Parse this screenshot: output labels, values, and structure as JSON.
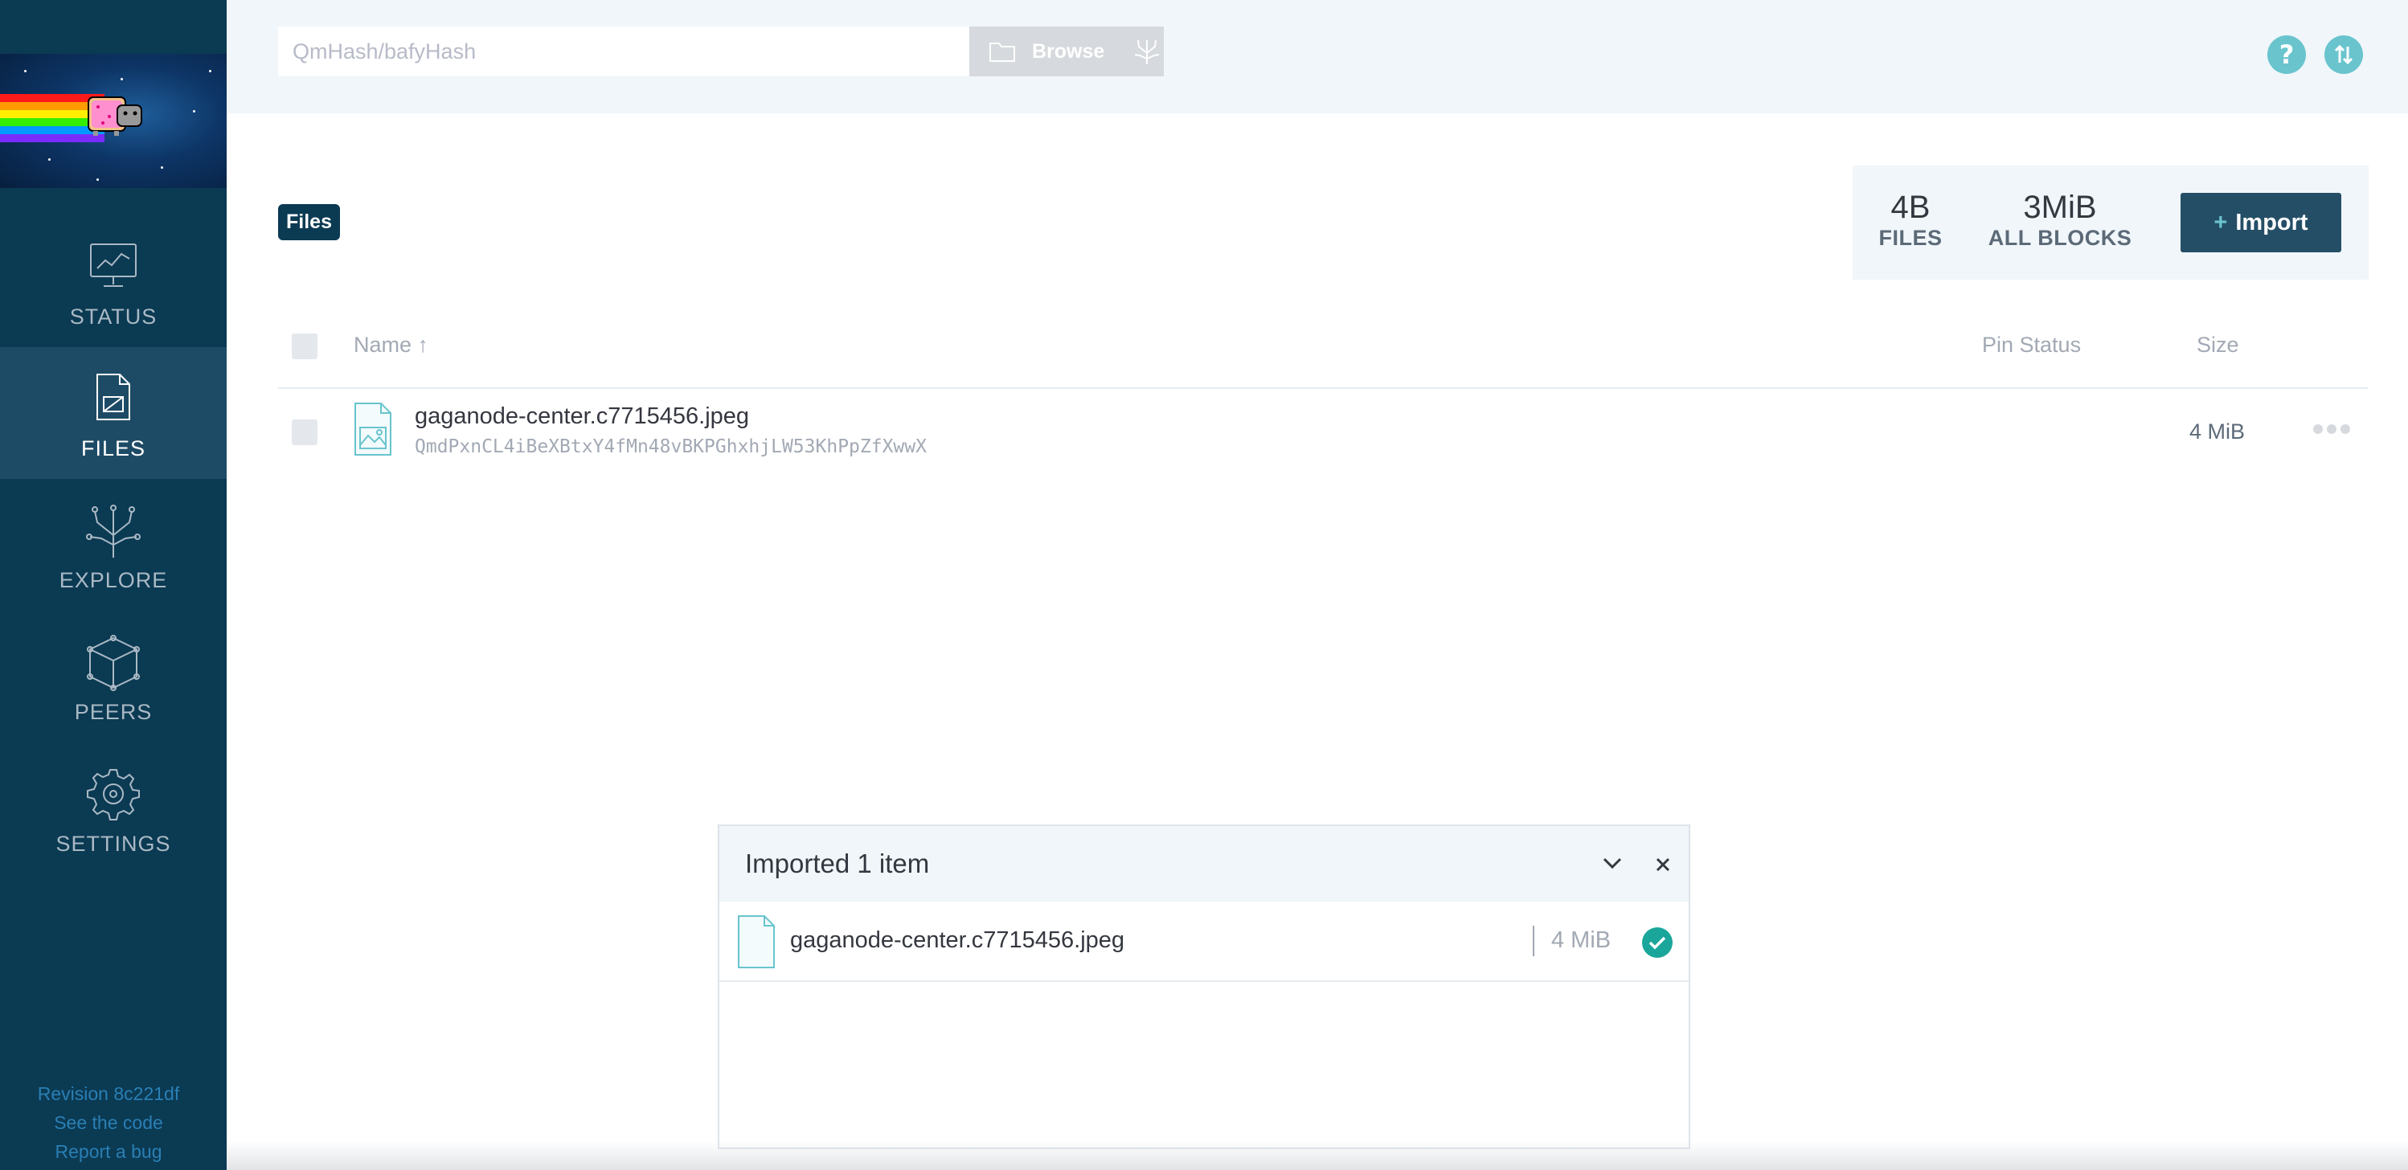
{
  "sidebar": {
    "items": [
      {
        "label": "STATUS",
        "icon": "status-monitor-icon"
      },
      {
        "label": "FILES",
        "icon": "files-icon"
      },
      {
        "label": "EXPLORE",
        "icon": "explore-tree-icon"
      },
      {
        "label": "PEERS",
        "icon": "peers-cube-icon"
      },
      {
        "label": "SETTINGS",
        "icon": "gear-icon"
      }
    ],
    "active": "FILES",
    "footer": {
      "revision": "Revision 8c221df",
      "code": "See the code",
      "bug": "Report a bug"
    }
  },
  "topbar": {
    "search_placeholder": "QmHash/bafyHash",
    "browse_label": "Browse"
  },
  "header": {
    "breadcrumb": "Files",
    "stats": [
      {
        "value": "4B",
        "label": "FILES"
      },
      {
        "value": "3MiB",
        "label": "ALL BLOCKS"
      }
    ],
    "import_plus": "+",
    "import_label": "Import"
  },
  "table": {
    "columns": {
      "name": "Name ↑",
      "pin": "Pin Status",
      "size": "Size"
    },
    "rows": [
      {
        "name": "gaganode-center.c7715456.jpeg",
        "hash": "QmdPxnCL4iBeXBtxY4fMn48vBKPGhxhjLW53KhPpZfXwwX",
        "pin": "",
        "size": "4 MiB"
      }
    ]
  },
  "import_panel": {
    "title": "Imported 1 item",
    "items": [
      {
        "name": "gaganode-center.c7715456.jpeg",
        "size": "4 MiB",
        "status": "done"
      }
    ]
  },
  "colors": {
    "sidebar": "#0b3a53",
    "accent": "#69c4cd",
    "import_button": "#244e66",
    "success": "#1aa69a"
  }
}
